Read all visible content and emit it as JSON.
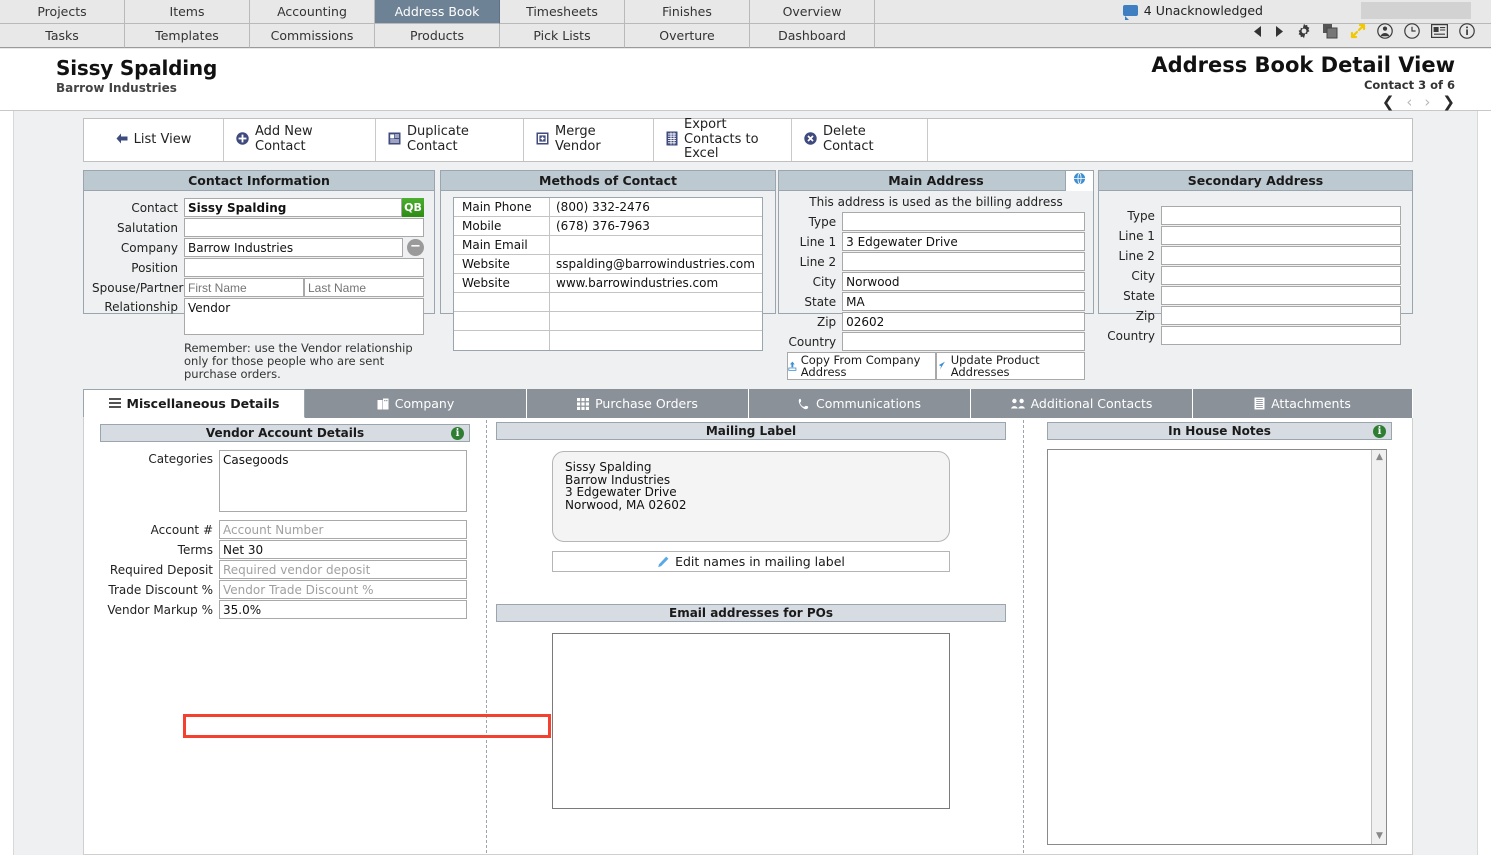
{
  "nav": {
    "row1": [
      {
        "label": "Projects",
        "active": false
      },
      {
        "label": "Items",
        "active": false
      },
      {
        "label": "Accounting",
        "active": false
      },
      {
        "label": "Address Book",
        "active": true
      },
      {
        "label": "Timesheets",
        "active": false
      },
      {
        "label": "Finishes",
        "active": false
      },
      {
        "label": "Overview",
        "active": false
      }
    ],
    "row2": [
      {
        "label": "Tasks",
        "active": false
      },
      {
        "label": "Templates",
        "active": false
      },
      {
        "label": "Commissions",
        "active": false
      },
      {
        "label": "Products",
        "active": false
      },
      {
        "label": "Pick Lists",
        "active": false
      },
      {
        "label": "Overture",
        "active": false
      },
      {
        "label": "Dashboard",
        "active": false
      }
    ],
    "unacknowledged": "4 Unacknowledged",
    "icons": [
      "prev-arrow-icon",
      "next-arrow-icon",
      "gear-icon",
      "copy-icon",
      "expand-icon",
      "person-icon",
      "clock-icon",
      "card-icon",
      "info-icon"
    ]
  },
  "header": {
    "contact_name": "Sissy Spalding",
    "company": "Barrow Industries",
    "title": "Address Book Detail View",
    "position": "Contact 3 of 6",
    "pager": [
      "first",
      "prev",
      "next",
      "last"
    ]
  },
  "toolbar": [
    {
      "label": "List View",
      "icon": "back-arrow-icon"
    },
    {
      "label": "Add New Contact",
      "icon": "plus-circle-icon"
    },
    {
      "label": "Duplicate Contact",
      "icon": "duplicate-icon"
    },
    {
      "label": "Merge Vendor",
      "icon": "merge-icon"
    },
    {
      "label": "Export Contacts to Excel",
      "icon": "spreadsheet-icon"
    },
    {
      "label": "Delete Contact",
      "icon": "delete-circle-icon"
    }
  ],
  "contact_information": {
    "title": "Contact Information",
    "fields": [
      {
        "label": "Contact",
        "value": "Sissy Spalding",
        "placeholder": "",
        "bold": true
      },
      {
        "label": "Salutation",
        "value": "",
        "placeholder": ""
      },
      {
        "label": "Company",
        "value": "Barrow Industries",
        "placeholder": ""
      },
      {
        "label": "Position",
        "value": "",
        "placeholder": ""
      }
    ],
    "spouse_label": "Spouse/Partner",
    "spouse_first_placeholder": "First Name",
    "spouse_last_placeholder": "Last Name",
    "relationship_label": "Relationship",
    "relationship_value": "Vendor",
    "qb_badge": "QB",
    "remove_company_icon": "minus-circle-icon",
    "note": "Remember: use the Vendor relationship only for those people who are sent purchase orders."
  },
  "methods_of_contact": {
    "title": "Methods of Contact",
    "rows": [
      {
        "key": "Main Phone",
        "value": "(800) 332-2476"
      },
      {
        "key": "Mobile",
        "value": "(678) 376-7963"
      },
      {
        "key": "Main Email",
        "value": ""
      },
      {
        "key": "Website",
        "value": "sspalding@barrowindustries.com"
      },
      {
        "key": "Website",
        "value": "www.barrowindustries.com"
      },
      {
        "key": "",
        "value": ""
      },
      {
        "key": "",
        "value": ""
      },
      {
        "key": "",
        "value": ""
      }
    ]
  },
  "main_address": {
    "title": "Main Address",
    "globe_icon": "globe-icon",
    "billing_note": "This address is used as the billing address",
    "fields": [
      {
        "label": "Type",
        "value": ""
      },
      {
        "label": "Line 1",
        "value": "3 Edgewater Drive"
      },
      {
        "label": "Line 2",
        "value": ""
      },
      {
        "label": "City",
        "value": "Norwood"
      },
      {
        "label": "State",
        "value": "MA"
      },
      {
        "label": "Zip",
        "value": "02602"
      },
      {
        "label": "Country",
        "value": ""
      }
    ],
    "buttons": [
      {
        "label": "Copy From Company Address",
        "icon": "upload-icon"
      },
      {
        "label": "Update Product Addresses",
        "icon": "cursor-arrow-icon"
      }
    ]
  },
  "secondary_address": {
    "title": "Secondary Address",
    "fields": [
      {
        "label": "Type",
        "value": ""
      },
      {
        "label": "Line 1",
        "value": ""
      },
      {
        "label": "Line 2",
        "value": ""
      },
      {
        "label": "City",
        "value": ""
      },
      {
        "label": "State",
        "value": ""
      },
      {
        "label": "Zip",
        "value": ""
      },
      {
        "label": "Country",
        "value": ""
      }
    ]
  },
  "tabs": [
    {
      "label": "Miscellaneous Details",
      "icon": "list-icon",
      "active": true
    },
    {
      "label": "Company",
      "icon": "building-icon",
      "active": false
    },
    {
      "label": "Purchase Orders",
      "icon": "grid-icon",
      "active": false
    },
    {
      "label": "Communications",
      "icon": "phone-icon",
      "active": false
    },
    {
      "label": "Additional Contacts",
      "icon": "people-icon",
      "active": false
    },
    {
      "label": "Attachments",
      "icon": "document-icon",
      "active": false
    }
  ],
  "vendor_account_details": {
    "title": "Vendor Account Details",
    "info_icon": "info-icon",
    "categories_label": "Categories",
    "categories_value": "Casegoods",
    "fields": [
      {
        "label": "Account #",
        "value": "",
        "placeholder": "Account Number"
      },
      {
        "label": "Terms",
        "value": "Net 30",
        "placeholder": ""
      },
      {
        "label": "Required Deposit",
        "value": "",
        "placeholder": "Required vendor deposit"
      },
      {
        "label": "Trade Discount %",
        "value": "",
        "placeholder": "Vendor Trade Discount %"
      },
      {
        "label": "Vendor Markup %",
        "value": "35.0%",
        "placeholder": "",
        "highlighted": true
      }
    ],
    "highlight_color": "#f4402f"
  },
  "mailing_label": {
    "title": "Mailing Label",
    "lines": [
      "Sissy Spalding",
      "Barrow Industries",
      "3 Edgewater Drive",
      "Norwood, MA 02602"
    ],
    "edit_button": "Edit names in mailing label",
    "edit_icon": "pencil-icon"
  },
  "email_addresses_for_pos": {
    "title": "Email addresses for POs",
    "value": ""
  },
  "in_house_notes": {
    "title": "In House Notes",
    "info_icon": "info-icon",
    "value": "",
    "scroll_up_icon": "chevron-up-icon",
    "scroll_down_icon": "chevron-down-icon"
  }
}
